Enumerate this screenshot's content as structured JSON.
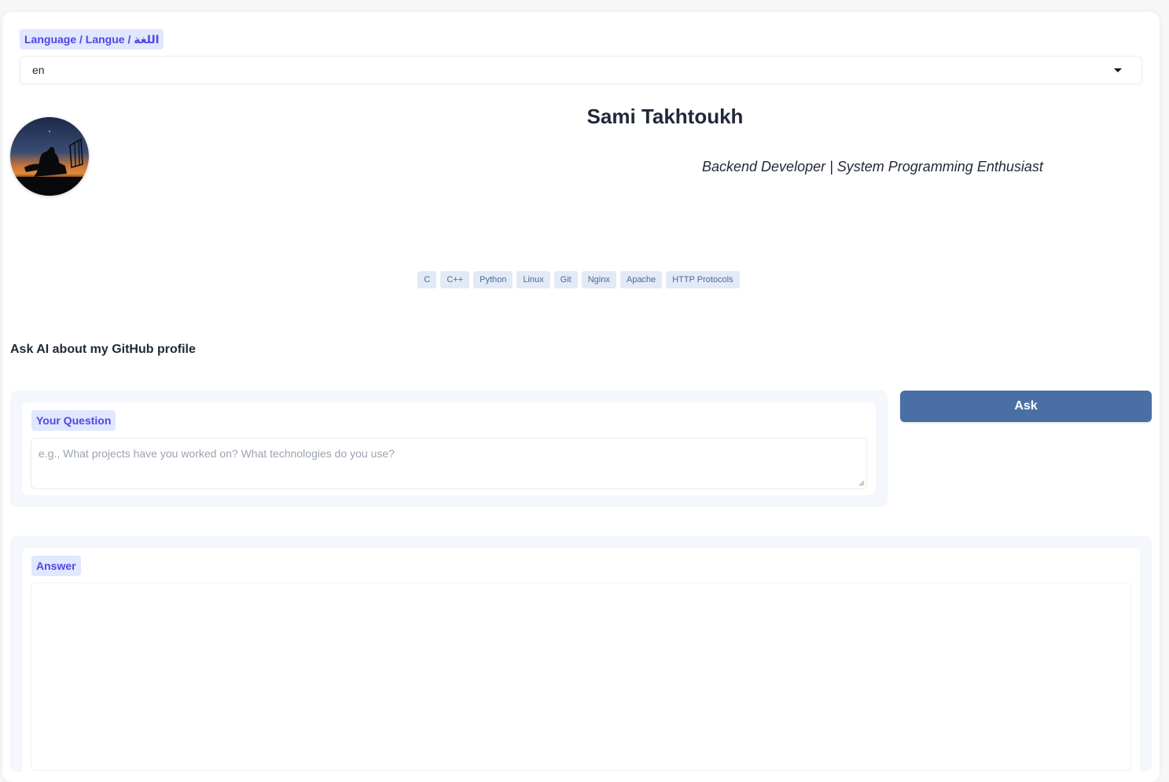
{
  "language": {
    "label": "Language / Langue / اللغة",
    "selected": "en"
  },
  "profile": {
    "name": "Sami Takhtoukh",
    "tagline": "Backend Developer | System Programming Enthusiast"
  },
  "skills": [
    "C",
    "C++",
    "Python",
    "Linux",
    "Git",
    "Nginx",
    "Apache",
    "HTTP Protocols"
  ],
  "ask_section": {
    "title": "Ask AI about my GitHub profile",
    "question_label": "Your Question",
    "question_placeholder": "e.g., What projects have you worked on? What technologies do you use?",
    "ask_button": "Ask",
    "answer_label": "Answer"
  },
  "icons": {
    "dropdown": "chevron-down-icon",
    "resize": "resize-grip-icon"
  },
  "colors": {
    "accent": "#4a6fa5",
    "label_bg": "#e0e7ff",
    "label_text": "#4f46e5",
    "skill_bg": "#e2eaf5",
    "skill_text": "#4b6a9b"
  }
}
